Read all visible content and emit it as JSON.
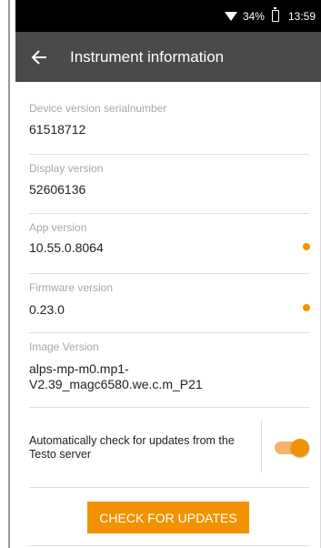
{
  "status_bar": {
    "battery": "34%",
    "time": "13:59",
    "icons": [
      "wifi-icon",
      "battery-icon"
    ]
  },
  "app_bar": {
    "title": "Instrument information",
    "back_icon": "arrow-left-icon"
  },
  "info_rows": [
    {
      "label": "Device version serialnumber",
      "value": "61518712"
    },
    {
      "label": "Display version",
      "value": "52606136"
    },
    {
      "label": "App version",
      "value": "10.55.0.8064"
    },
    {
      "label": "Firmware version",
      "value": "0.23.0"
    },
    {
      "label": "Image Version",
      "value": "alps-mp-m0.mp1-V2.39_magc6580.we.c.m_P21"
    }
  ],
  "auto_update": {
    "label": "Automatically check for updates from the Testo server",
    "enabled": true
  },
  "check_button": {
    "label": "CHECK FOR UPDATES"
  },
  "colors": {
    "accent": "#f39200",
    "app_bar": "#4a4a4a",
    "status_bar": "#000000"
  }
}
